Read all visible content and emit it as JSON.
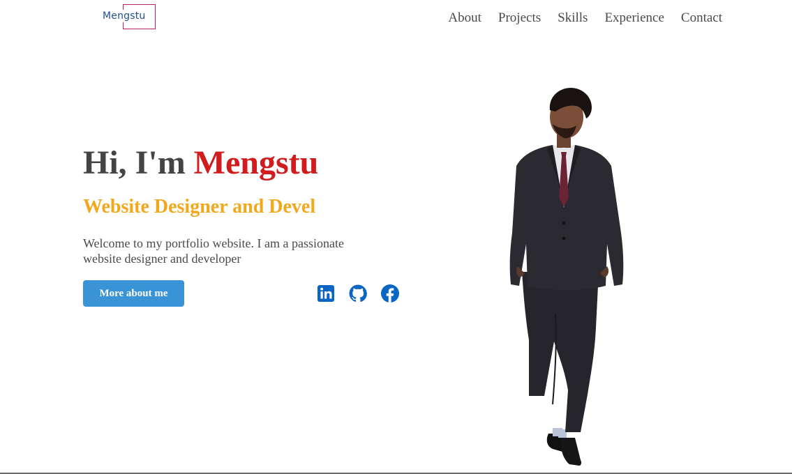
{
  "header": {
    "logo_text": "Mengstu",
    "nav": [
      {
        "label": "About"
      },
      {
        "label": "Projects"
      },
      {
        "label": "Skills"
      },
      {
        "label": "Experience"
      },
      {
        "label": "Contact"
      }
    ]
  },
  "hero": {
    "greeting": "Hi, I'm ",
    "name": "Mengstu",
    "subtitle": "Website Designer and Devel",
    "description": "Welcome to my portfolio website. I am a passionate website designer and developer",
    "button_label": "More about me"
  },
  "socials": [
    {
      "icon": "linkedin-icon"
    },
    {
      "icon": "github-icon"
    },
    {
      "icon": "facebook-icon"
    }
  ],
  "colors": {
    "name_accent": "#d01c1c",
    "subtitle": "#f2a81d",
    "button": "#3a93d6",
    "social_icons": "#0a66c2",
    "logo_frame": "#b0206e",
    "logo_text": "#1f4f8c"
  }
}
